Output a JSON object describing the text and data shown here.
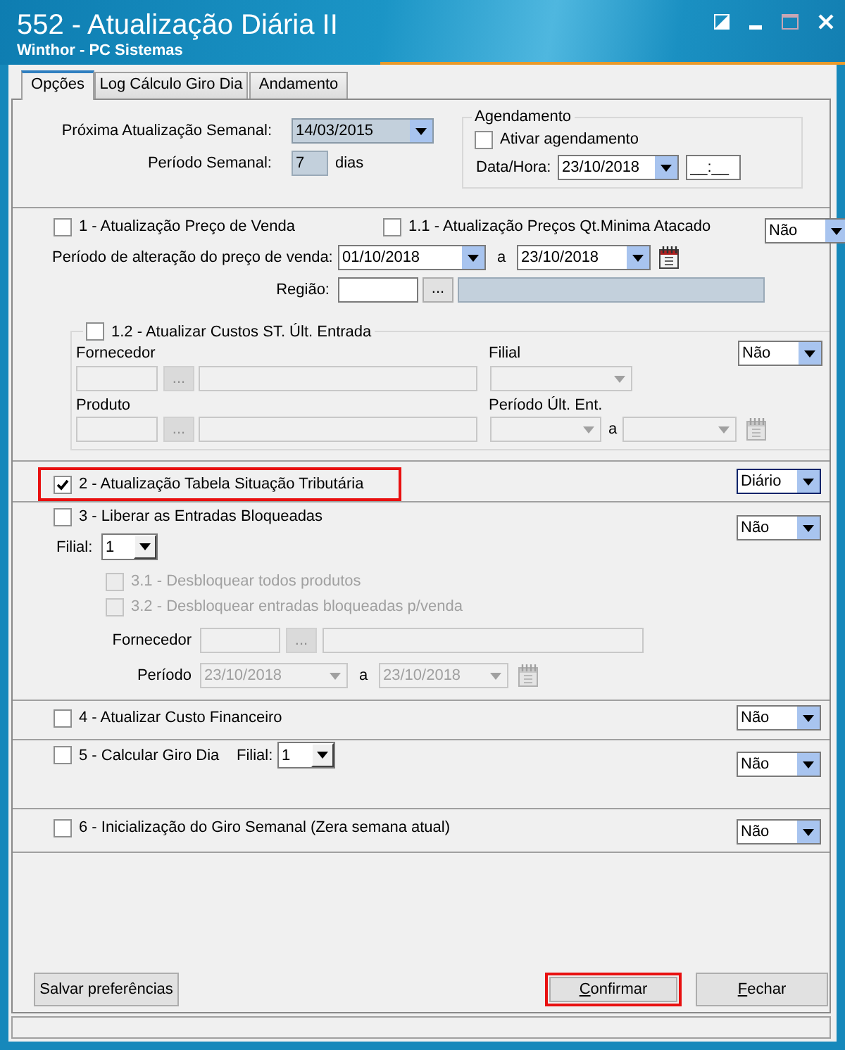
{
  "window": {
    "title": "552 - Atualização Diária II",
    "subtitle": "Winthor - PC Sistemas"
  },
  "tabs": [
    {
      "label": "Opções",
      "selected": true
    },
    {
      "label": "Log Cálculo Giro Dia",
      "selected": false
    },
    {
      "label": "Andamento",
      "selected": false
    }
  ],
  "weekly": {
    "next_update_label": "Próxima Atualização Semanal:",
    "next_update": "14/03/2015",
    "period_label": "Período Semanal:",
    "period": "7",
    "period_unit": "dias"
  },
  "scheduling": {
    "title": "Agendamento",
    "enable": {
      "label": "Ativar agendamento",
      "checked": false
    },
    "datetime_label": "Data/Hora:",
    "date": "23/10/2018",
    "time": "__:__"
  },
  "price_update": {
    "option": {
      "label": "1 - Atualização Preço de Venda",
      "checked": false
    },
    "wholesale_option": {
      "label": "1.1 - Atualização Preços Qt.Minima Atacado",
      "checked": false
    },
    "frequency": "Não",
    "period_label": "Período de alteração do preço de venda:",
    "date_from": "01/10/2018",
    "range_separator": "a",
    "date_to": "23/10/2018",
    "region_label": "Região:",
    "lookup_label": "..."
  },
  "st_costs": {
    "option": {
      "label": "1.2 - Atualizar Custos ST. Últ. Entrada",
      "checked": false
    },
    "frequency": "Não",
    "disabled": true,
    "supplier_label": "Fornecedor",
    "lookup_label": "...",
    "branch_label": "Filial",
    "product_label": "Produto",
    "product_lookup_label": "...",
    "period_label": "Período Últ. Ent.",
    "range_separator": "a"
  },
  "tax_table": {
    "option": {
      "label": "2 - Atualização Tabela Situação Tributária",
      "checked": true
    },
    "frequency": "Diário",
    "frequency_focused": true,
    "highlighted": true
  },
  "release_entries": {
    "option": {
      "label": "3 - Liberar as Entradas Bloqueadas",
      "checked": false
    },
    "frequency": "Não",
    "branch_label": "Filial:",
    "branch": "1",
    "sub_options": [
      {
        "label": "3.1 - Desbloquear todos produtos",
        "checked": false,
        "disabled": true
      },
      {
        "label": "3.2 - Desbloquear entradas bloqueadas p/venda",
        "checked": false,
        "disabled": true
      }
    ],
    "disabled": true,
    "supplier_label": "Fornecedor",
    "lookup_label": "...",
    "period_label": "Período",
    "date_from": "23/10/2018",
    "range_separator": "a",
    "date_to": "23/10/2018"
  },
  "financial_cost": {
    "option": {
      "label": "4 - Atualizar Custo Financeiro",
      "checked": false
    },
    "frequency": "Não"
  },
  "turnover": {
    "option": {
      "label": "5 - Calcular Giro Dia",
      "checked": false
    },
    "branch_label": "Filial:",
    "branch": "1",
    "frequency": "Não"
  },
  "weekly_reset": {
    "option": {
      "label": "6 - Inicialização do Giro Semanal (Zera semana atual)",
      "checked": false
    },
    "frequency": "Não"
  },
  "buttons": [
    {
      "label": "Salvar preferências",
      "highlighted": false,
      "access_key": false
    },
    {
      "label": "Confirmar",
      "highlighted": true,
      "access_key": true
    },
    {
      "label": "Fechar",
      "highlighted": false,
      "access_key": true
    }
  ]
}
